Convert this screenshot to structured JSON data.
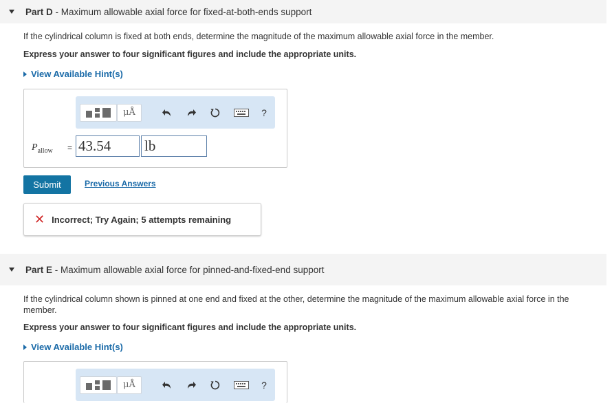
{
  "part_d": {
    "label": "Part D",
    "sep": " - ",
    "title": "Maximum allowable axial force for fixed-at-both-ends support",
    "question": "If the cylindrical column is fixed at both ends, determine the magnitude of the maximum allowable axial force in the member.",
    "express": "Express your answer to four significant figures and include the appropriate units.",
    "hint": "View Available Hint(s)",
    "var_main": "P",
    "var_sub": "allow",
    "equals": "=",
    "value": "43.54",
    "unit": "lb",
    "submit": "Submit",
    "previous": "Previous Answers",
    "feedback": "Incorrect; Try Again; 5 attempts remaining"
  },
  "part_e": {
    "label": "Part E",
    "sep": " - ",
    "title": "Maximum allowable axial force for pinned-and-fixed-end support",
    "question": "If the cylindrical column shown is pinned at one end and fixed at the other, determine the magnitude of the maximum allowable axial force in the member.",
    "express": "Express your answer to four significant figures and include the appropriate units.",
    "hint": "View Available Hint(s)"
  },
  "toolbar": {
    "mu_label": "μÅ",
    "help_label": "?",
    "icons": [
      "templates-icon",
      "units-icon",
      "undo-icon",
      "redo-icon",
      "reset-icon",
      "keyboard-icon",
      "help-icon"
    ]
  },
  "colors": {
    "link": "#1a6aa8",
    "submit_bg": "#1374a3",
    "toolbar_bg": "#d7e6f5",
    "incorrect": "#d02828"
  }
}
